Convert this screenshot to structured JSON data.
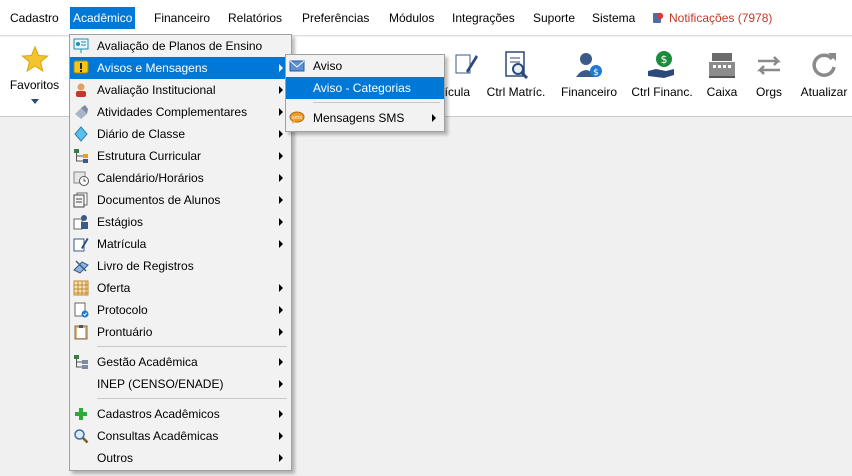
{
  "menubar": {
    "items": [
      {
        "label": "Cadastro"
      },
      {
        "label": "Acadêmico"
      },
      {
        "label": "Financeiro"
      },
      {
        "label": "Relatórios"
      },
      {
        "label": "Preferências"
      },
      {
        "label": "Módulos"
      },
      {
        "label": "Integrações"
      },
      {
        "label": "Suporte"
      },
      {
        "label": "Sistema"
      }
    ],
    "notifications": "Notificações (7978)"
  },
  "toolbar": {
    "favorites": "Favoritos",
    "partial_matricula": "ícula",
    "ctrl_matric": "Ctrl Matríc.",
    "financeiro": "Financeiro",
    "ctrl_financ": "Ctrl Financ.",
    "caixa": "Caixa",
    "orgs": "Orgs",
    "atualizar": "Atualizar"
  },
  "academico_menu": {
    "items": [
      {
        "label": "Avaliação de Planos de Ensino",
        "icon": "presentation-icon"
      },
      {
        "label": "Avisos e Mensagens",
        "icon": "warning-icon"
      },
      {
        "label": "Avaliação Institucional",
        "icon": "person-icon"
      },
      {
        "label": "Atividades Complementares",
        "icon": "eraser-icon"
      },
      {
        "label": "Diário de Classe",
        "icon": "diamond-icon"
      },
      {
        "label": "Estrutura Curricular",
        "icon": "org-chart-icon"
      },
      {
        "label": "Calendário/Horários",
        "icon": "calendar-clock-icon"
      },
      {
        "label": "Documentos de Alunos",
        "icon": "documents-icon"
      },
      {
        "label": "Estágios",
        "icon": "intern-icon"
      },
      {
        "label": "Matrícula",
        "icon": "enrollment-icon"
      },
      {
        "label": "Livro de Registros",
        "icon": "book-pen-icon"
      },
      {
        "label": "Oferta",
        "icon": "grid-icon"
      },
      {
        "label": "Protocolo",
        "icon": "protocol-icon"
      },
      {
        "label": "Prontuário",
        "icon": "clipboard-icon"
      },
      {
        "label": "Gestão Acadêmica",
        "icon": "management-icon"
      },
      {
        "label": "INEP (CENSO/ENADE)",
        "icon": ""
      },
      {
        "label": "Cadastros Acadêmicos",
        "icon": "plus-icon"
      },
      {
        "label": "Consultas Acadêmicas",
        "icon": "magnifier-icon"
      },
      {
        "label": "Outros",
        "icon": ""
      }
    ]
  },
  "avisos_submenu": {
    "items": [
      {
        "label": "Aviso",
        "icon": "envelope-icon"
      },
      {
        "label": "Aviso - Categorias",
        "icon": ""
      },
      {
        "label": "Mensagens SMS",
        "icon": "sms-icon"
      }
    ]
  },
  "colors": {
    "highlight": "#0078d7",
    "notification": "#c0392b"
  }
}
